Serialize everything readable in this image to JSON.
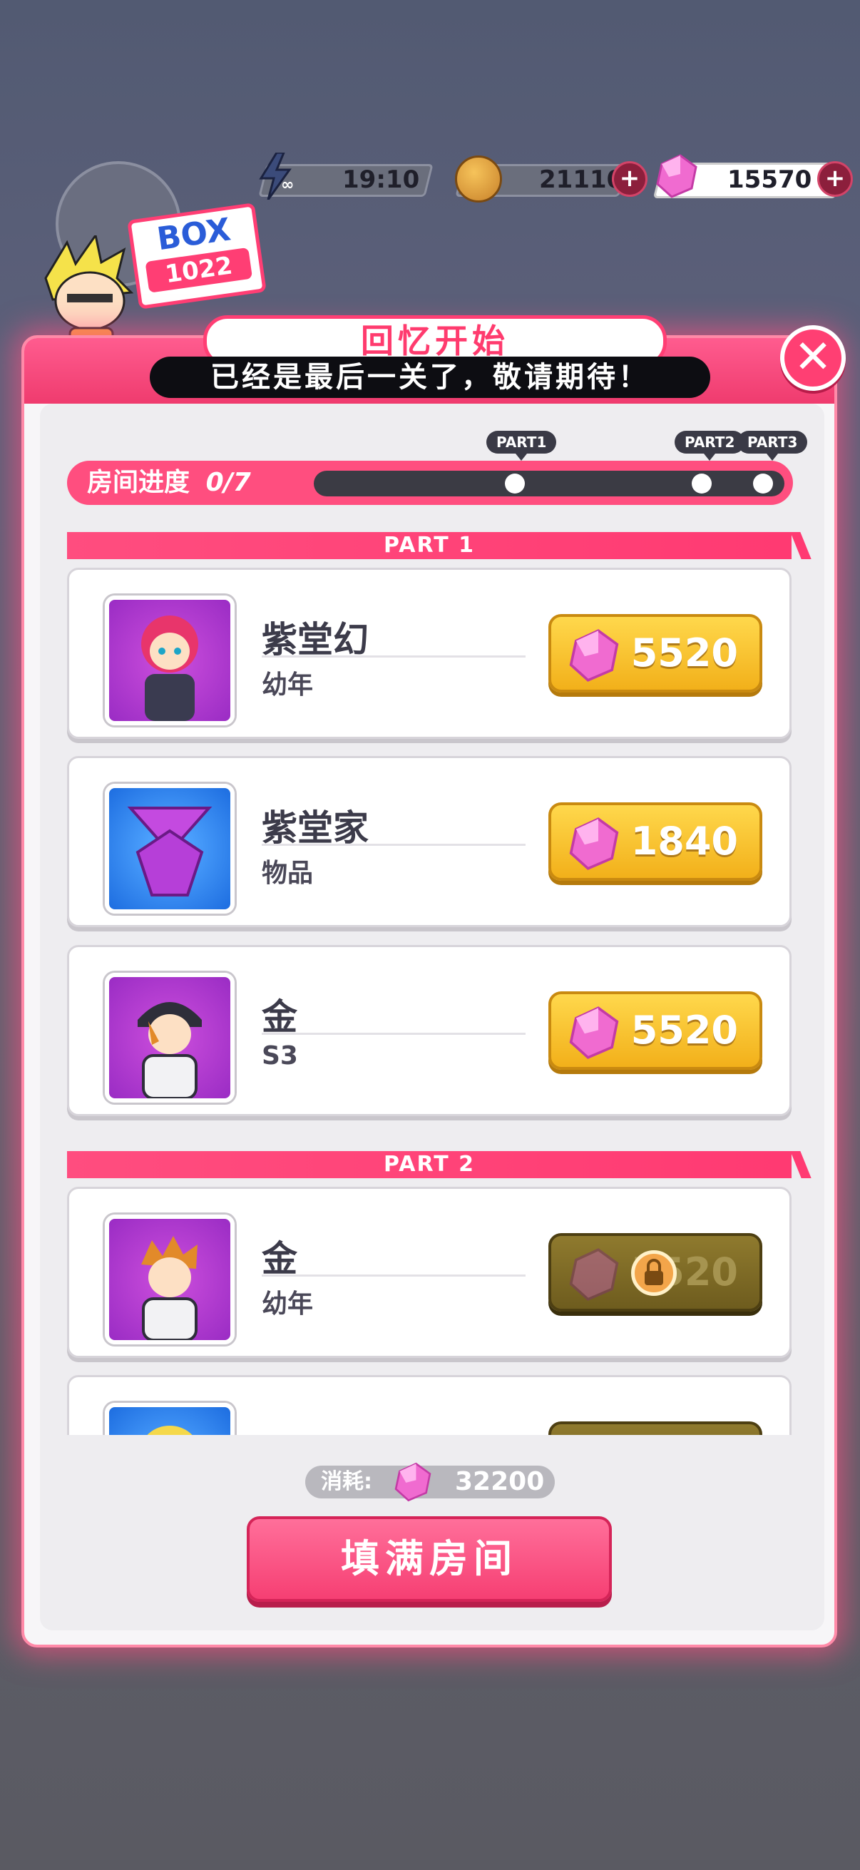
{
  "resources": {
    "energy": "19:10",
    "coins": "21110",
    "gems": "15570"
  },
  "badge": {
    "line1": "BOX",
    "line2": "1022"
  },
  "dialog": {
    "title": "回忆开始",
    "subtitle": "已经是最后一关了，敬请期待！",
    "close_symbol": "✕"
  },
  "progress": {
    "label": "房间进度",
    "value": "0/7",
    "parts": [
      "PART1",
      "PART2",
      "PART3"
    ]
  },
  "sections": [
    {
      "header": "PART 1",
      "items": [
        {
          "name": "紫堂幻",
          "sub": "幼年",
          "price": "5520",
          "locked": false
        },
        {
          "name": "紫堂家",
          "sub": "物品",
          "price": "1840",
          "locked": false
        },
        {
          "name": "金",
          "sub": "S3",
          "price": "5520",
          "locked": false
        }
      ]
    },
    {
      "header": "PART 2",
      "items": [
        {
          "name": "金",
          "sub": "幼年",
          "price": "5520",
          "locked": true
        }
      ]
    }
  ],
  "footer": {
    "cost_label": "消耗:",
    "cost_value": "32200",
    "fill_button": "填满房间"
  },
  "colors": {
    "accent": "#ff3e74",
    "gold": "#f7c52a",
    "gem": "#e85fc4"
  }
}
